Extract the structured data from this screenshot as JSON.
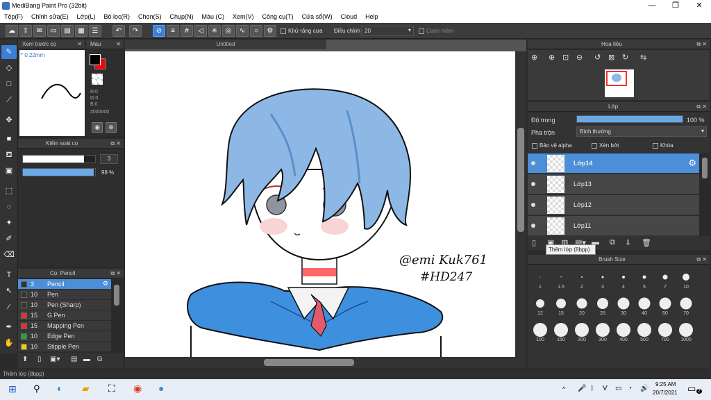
{
  "app": {
    "title": "MediBang Paint Pro (32bit)",
    "min": "—",
    "max": "❐",
    "close": "✕"
  },
  "menu": [
    "Tệp(F)",
    "Chỉnh sửa(E)",
    "Lớp(L)",
    "Bộ lọc(R)",
    "Chọn(S)",
    "Chụp(N)",
    "Màu (C)",
    "Xem(V)",
    "Công cụ(T)",
    "Cửa sổ(W)",
    "Cloud",
    "Help"
  ],
  "toolbar": {
    "antialias": "Khử răng cưa",
    "adjust_label": "Điều chỉnh",
    "adjust_value": "20",
    "smooth": "Canh mềm"
  },
  "brush_preview": {
    "title": "Xem trước cọ",
    "size": "* 0.22mm"
  },
  "color_panel": {
    "title": "Màu",
    "r": "R:0",
    "g": "G:0",
    "b": "B:0",
    "hex": "#000000",
    "fg": "#000000",
    "bg": "#ff0000"
  },
  "brush_control": {
    "title": "Kiểm soát cọ",
    "size_value": "3",
    "opacity_value": "98 %",
    "opacity": 0.98,
    "size_fill": 0.85
  },
  "brush_list": {
    "title": "Cọ: Pencil",
    "items": [
      {
        "size": "3",
        "name": "Pencil",
        "color": "#333333"
      },
      {
        "size": "10",
        "name": "Pen",
        "color": "#333333"
      },
      {
        "size": "10",
        "name": "Pen (Sharp)",
        "color": "#333333"
      },
      {
        "size": "15",
        "name": "G Pen",
        "color": "#e53030"
      },
      {
        "size": "15",
        "name": "Mapping Pen",
        "color": "#e53030"
      },
      {
        "size": "10",
        "name": "Edge Pen",
        "color": "#2aa52a"
      },
      {
        "size": "10",
        "name": "Stipple Pen",
        "color": "#e8d800"
      }
    ]
  },
  "canvas": {
    "tab": "Untitled",
    "signature_line1": "@emi Kuk761",
    "signature_line2": "#HD247"
  },
  "navigator": {
    "title": "Hoa tiêu"
  },
  "layer_panel": {
    "title": "Lớp",
    "opacity_label": "Độ trong",
    "opacity_value": "100 %",
    "opacity": 1.0,
    "blend_label": "Pha trộn",
    "blend_value": "Bình thường",
    "protect_alpha": "Bảo vệ alpha",
    "clipping": "Xén bớt",
    "lock": "Khóa",
    "layers": [
      {
        "name": "Lớp14"
      },
      {
        "name": "Lớp13"
      },
      {
        "name": "Lớp12"
      },
      {
        "name": "Lớp11"
      }
    ],
    "tooltip": "Thêm lớp (8bpp)"
  },
  "brush_size": {
    "title": "Brush Size",
    "sizes": [
      "1",
      "1.5",
      "2",
      "3",
      "4",
      "5",
      "7",
      "10",
      "12",
      "15",
      "20",
      "25",
      "30",
      "40",
      "50",
      "70",
      "100",
      "150",
      "200",
      "300",
      "400",
      "500",
      "700",
      "1000"
    ]
  },
  "status": "Thêm lớp (8bpp)",
  "taskbar": {
    "time": "9:25 AM",
    "date": "20/7/2021",
    "lang": "VIE",
    "notif": "2"
  }
}
